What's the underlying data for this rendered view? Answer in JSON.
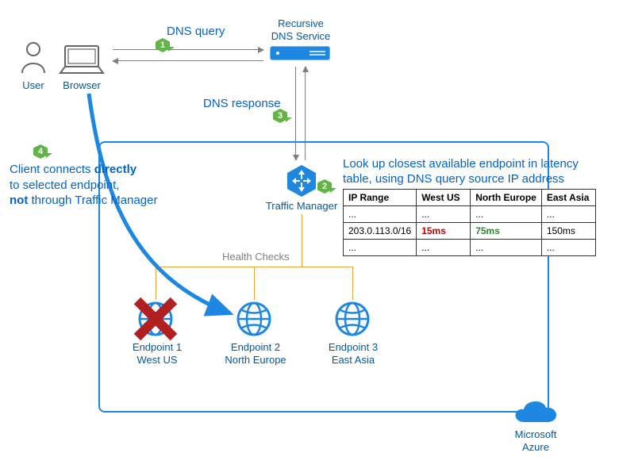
{
  "user_label": "User",
  "browser_label": "Browser",
  "dns_service_label_line1": "Recursive",
  "dns_service_label_line2": "DNS Service",
  "traffic_manager_label": "Traffic Manager",
  "azure_label_line1": "Microsoft",
  "azure_label_line2": "Azure",
  "dns_query_label": "DNS query",
  "dns_response_label": "DNS response",
  "health_checks_label": "Health Checks",
  "step1_badge": "1",
  "step2_badge": "2",
  "step3_badge": "3",
  "step4_badge": "4",
  "step2_text_line1": "Look up closest available endpoint in latency",
  "step2_text_line2": "table, using DNS query source IP address",
  "step4_text_line1": "Client connects ",
  "step4_text_bold1": "directly",
  "step4_text_line2": "to selected endpoint,",
  "step4_text_bold2": "not",
  "step4_text_line3": " through Traffic Manager",
  "endpoint1_line1": "Endpoint 1",
  "endpoint1_line2": "West US",
  "endpoint2_line1": "Endpoint 2",
  "endpoint2_line2": "North Europe",
  "endpoint3_line1": "Endpoint 3",
  "endpoint3_line2": "East Asia",
  "table": {
    "headers": [
      "IP Range",
      "West US",
      "North Europe",
      "East Asia"
    ],
    "rows": [
      [
        "...",
        "...",
        "...",
        "..."
      ],
      [
        "203.0.113.0/16",
        "15ms",
        "75ms",
        "150ms"
      ],
      [
        "...",
        "...",
        "...",
        "..."
      ]
    ]
  },
  "chart_data": {
    "type": "table",
    "title": "Latency lookup table",
    "columns": [
      "IP Range",
      "West US",
      "North Europe",
      "East Asia"
    ],
    "rows": [
      {
        "IP Range": "...",
        "West US": "...",
        "North Europe": "...",
        "East Asia": "..."
      },
      {
        "IP Range": "203.0.113.0/16",
        "West US": "15ms",
        "North Europe": "75ms",
        "East Asia": "150ms"
      },
      {
        "IP Range": "...",
        "West US": "...",
        "North Europe": "...",
        "East Asia": "..."
      }
    ],
    "highlight": {
      "row": 1,
      "red": "West US",
      "green": "North Europe"
    }
  }
}
